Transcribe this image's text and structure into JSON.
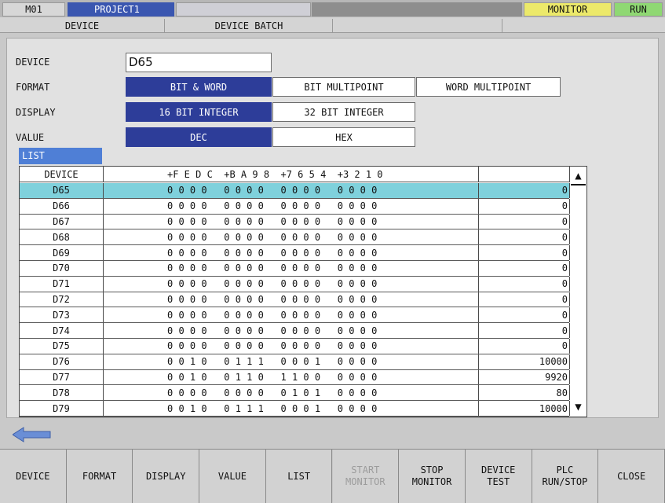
{
  "topbar": {
    "station": "M01",
    "project": "PROJECT1",
    "mode": "MONITOR",
    "status": "RUN",
    "colors": {
      "project_bg": "#3a56b0",
      "monitor_bg": "#ece96a",
      "run_bg": "#8fd873"
    }
  },
  "tabs": [
    "DEVICE",
    "DEVICE BATCH"
  ],
  "form": {
    "device_label": "DEVICE",
    "device_value": "D65",
    "format_label": "FORMAT",
    "format_options": [
      "BIT & WORD",
      "BIT MULTIPOINT",
      "WORD MULTIPOINT"
    ],
    "format_selected": "BIT & WORD",
    "display_label": "DISPLAY",
    "display_options": [
      "16 BIT INTEGER",
      "32 BIT INTEGER"
    ],
    "display_selected": "16 BIT INTEGER",
    "value_label": "VALUE",
    "value_options": [
      "DEC",
      "HEX"
    ],
    "value_selected": "DEC"
  },
  "list": {
    "tag": "LIST",
    "header": {
      "device": "DEVICE",
      "bits": "+F E D C  +B A 9 8  +7 6 5 4  +3 2 1 0"
    },
    "rows": [
      {
        "device": "D65",
        "bits": "0 0 0 0   0 0 0 0   0 0 0 0   0 0 0 0",
        "value": "0"
      },
      {
        "device": "D66",
        "bits": "0 0 0 0   0 0 0 0   0 0 0 0   0 0 0 0",
        "value": "0"
      },
      {
        "device": "D67",
        "bits": "0 0 0 0   0 0 0 0   0 0 0 0   0 0 0 0",
        "value": "0"
      },
      {
        "device": "D68",
        "bits": "0 0 0 0   0 0 0 0   0 0 0 0   0 0 0 0",
        "value": "0"
      },
      {
        "device": "D69",
        "bits": "0 0 0 0   0 0 0 0   0 0 0 0   0 0 0 0",
        "value": "0"
      },
      {
        "device": "D70",
        "bits": "0 0 0 0   0 0 0 0   0 0 0 0   0 0 0 0",
        "value": "0"
      },
      {
        "device": "D71",
        "bits": "0 0 0 0   0 0 0 0   0 0 0 0   0 0 0 0",
        "value": "0"
      },
      {
        "device": "D72",
        "bits": "0 0 0 0   0 0 0 0   0 0 0 0   0 0 0 0",
        "value": "0"
      },
      {
        "device": "D73",
        "bits": "0 0 0 0   0 0 0 0   0 0 0 0   0 0 0 0",
        "value": "0"
      },
      {
        "device": "D74",
        "bits": "0 0 0 0   0 0 0 0   0 0 0 0   0 0 0 0",
        "value": "0"
      },
      {
        "device": "D75",
        "bits": "0 0 0 0   0 0 0 0   0 0 0 0   0 0 0 0",
        "value": "0"
      },
      {
        "device": "D76",
        "bits": "0 0 1 0   0 1 1 1   0 0 0 1   0 0 0 0",
        "value": "10000"
      },
      {
        "device": "D77",
        "bits": "0 0 1 0   0 1 1 0   1 1 0 0   0 0 0 0",
        "value": "9920"
      },
      {
        "device": "D78",
        "bits": "0 0 0 0   0 0 0 0   0 1 0 1   0 0 0 0",
        "value": "80"
      },
      {
        "device": "D79",
        "bits": "0 0 1 0   0 1 1 1   0 0 0 1   0 0 0 0",
        "value": "10000"
      }
    ],
    "selected_row": "D65"
  },
  "icons": {
    "scroll_up": "triangle-up-icon",
    "scroll_down": "triangle-down-icon",
    "back": "back-arrow-icon"
  },
  "fkeys": [
    {
      "label": "DEVICE",
      "enabled": true
    },
    {
      "label": "FORMAT",
      "enabled": true
    },
    {
      "label": "DISPLAY",
      "enabled": true
    },
    {
      "label": "VALUE",
      "enabled": true
    },
    {
      "label": "LIST",
      "enabled": true
    },
    {
      "label": "START\nMONITOR",
      "enabled": false
    },
    {
      "label": "STOP\nMONITOR",
      "enabled": true
    },
    {
      "label": "DEVICE\nTEST",
      "enabled": true
    },
    {
      "label": "PLC\nRUN/STOP",
      "enabled": true
    },
    {
      "label": "CLOSE",
      "enabled": true
    }
  ]
}
